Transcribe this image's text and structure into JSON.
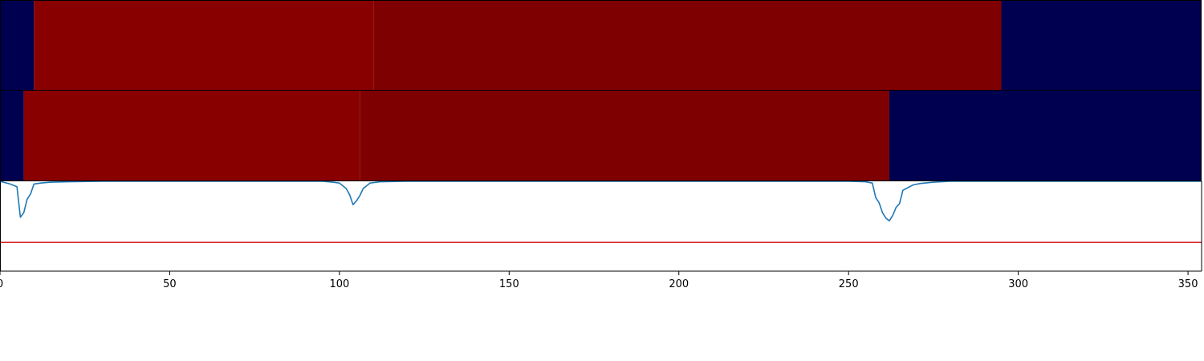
{
  "chart_data": [
    {
      "type": "heatmap",
      "title": "",
      "xlim": [
        0,
        354
      ],
      "segments": [
        {
          "x0": 0,
          "x1": 10,
          "color": "#000050"
        },
        {
          "x0": 10,
          "x1": 110,
          "color": "#890000"
        },
        {
          "x0": 110,
          "x1": 295,
          "color": "#7f0000"
        },
        {
          "x0": 295,
          "x1": 354,
          "color": "#000050"
        }
      ]
    },
    {
      "type": "heatmap",
      "title": "",
      "xlim": [
        0,
        354
      ],
      "segments": [
        {
          "x0": 0,
          "x1": 7,
          "color": "#000050"
        },
        {
          "x0": 7,
          "x1": 106,
          "color": "#890000"
        },
        {
          "x0": 106,
          "x1": 262,
          "color": "#7f0000"
        },
        {
          "x0": 262,
          "x1": 354,
          "color": "#000050"
        }
      ]
    },
    {
      "type": "line",
      "title": "",
      "xlabel": "",
      "ylabel": "",
      "xlim": [
        0,
        354
      ],
      "ylim": [
        -1.0,
        0.0
      ],
      "xticks": [
        0,
        50,
        100,
        150,
        200,
        250,
        300,
        350
      ],
      "grid": false,
      "series": [
        {
          "color": "#1f77b4",
          "points": [
            [
              0,
              0.0
            ],
            [
              1,
              -0.01
            ],
            [
              3,
              -0.03
            ],
            [
              5,
              -0.06
            ],
            [
              6,
              -0.4
            ],
            [
              7,
              -0.35
            ],
            [
              8,
              -0.2
            ],
            [
              9,
              -0.14
            ],
            [
              10,
              -0.03
            ],
            [
              12,
              -0.02
            ],
            [
              15,
              -0.01
            ],
            [
              20,
              -0.005
            ],
            [
              30,
              0.0
            ],
            [
              95,
              0.0
            ],
            [
              98,
              -0.01
            ],
            [
              100,
              -0.02
            ],
            [
              102,
              -0.08
            ],
            [
              103,
              -0.15
            ],
            [
              104,
              -0.26
            ],
            [
              105,
              -0.22
            ],
            [
              106,
              -0.16
            ],
            [
              107,
              -0.08
            ],
            [
              108,
              -0.05
            ],
            [
              109,
              -0.02
            ],
            [
              112,
              -0.005
            ],
            [
              120,
              0.0
            ],
            [
              250,
              0.0
            ],
            [
              255,
              -0.005
            ],
            [
              257,
              -0.02
            ],
            [
              258,
              -0.18
            ],
            [
              259,
              -0.24
            ],
            [
              260,
              -0.35
            ],
            [
              261,
              -0.41
            ],
            [
              262,
              -0.44
            ],
            [
              263,
              -0.38
            ],
            [
              264,
              -0.29
            ],
            [
              265,
              -0.25
            ],
            [
              266,
              -0.1
            ],
            [
              267,
              -0.08
            ],
            [
              268,
              -0.06
            ],
            [
              269,
              -0.04
            ],
            [
              271,
              -0.025
            ],
            [
              275,
              -0.01
            ],
            [
              280,
              0.0
            ],
            [
              354,
              0.0
            ]
          ]
        },
        {
          "color": "#d62728",
          "points": [
            [
              0,
              -0.68
            ],
            [
              354,
              -0.68
            ]
          ]
        }
      ]
    }
  ]
}
